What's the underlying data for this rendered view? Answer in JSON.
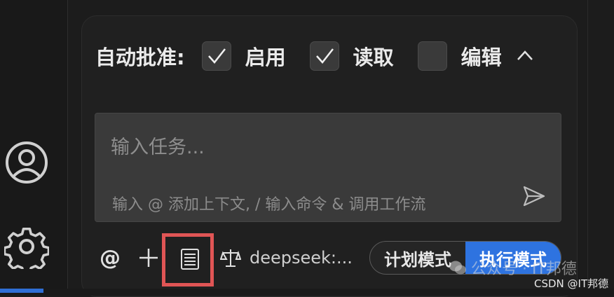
{
  "sidebar": {
    "icons": [
      {
        "name": "account-icon"
      },
      {
        "name": "settings-gear-icon"
      }
    ]
  },
  "auto_approve": {
    "label": "自动批准:",
    "options": [
      {
        "label": "启用",
        "checked": true
      },
      {
        "label": "读取",
        "checked": true
      },
      {
        "label": "编辑",
        "checked": false
      }
    ],
    "collapse_icon": "chevron-up-icon"
  },
  "input": {
    "placeholder": "输入任务...",
    "hint": "输入 @ 添加上下文, / 输入命令 & 调用工作流",
    "send_icon": "send-icon"
  },
  "toolbar": {
    "mention_label": "@",
    "add_icon": "plus-icon",
    "server_icon": "mcp-server-icon",
    "model_icon": "balance-scale-icon",
    "model_label": "deepseek:...",
    "modes": {
      "plan": "计划模式",
      "act": "执行模式",
      "active": "act"
    },
    "accent_color": "#2e73e0",
    "highlight_color": "#e05555"
  },
  "watermark": {
    "wechat": "公众号 · IT邦德",
    "csdn": "CSDN @IT邦德"
  }
}
